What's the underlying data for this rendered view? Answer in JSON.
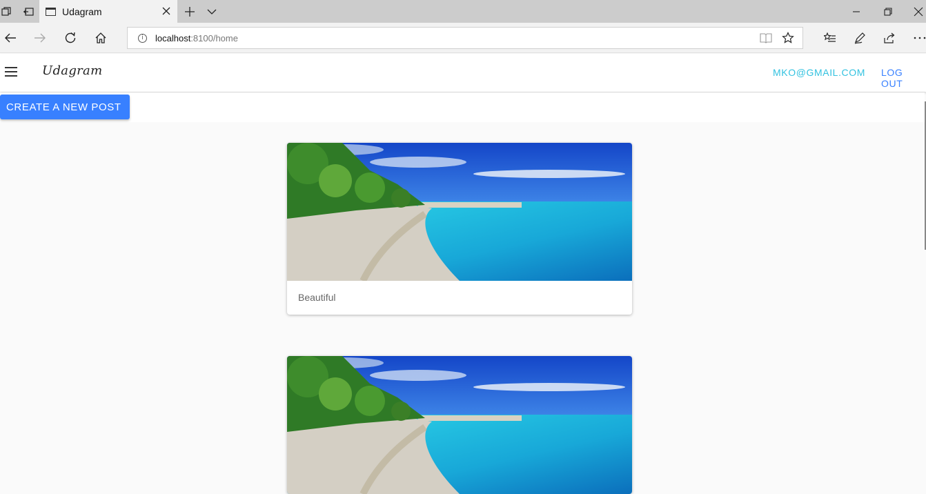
{
  "browser": {
    "tab_title": "Udagram",
    "url_host": "localhost",
    "url_rest": ":8100/home"
  },
  "app": {
    "title": "Udagram",
    "user_email": "MKO@GMAIL.COM",
    "logout_label": "LOG OUT",
    "create_button_label": "CREATE A NEW POST"
  },
  "posts": [
    {
      "caption": "Beautiful",
      "image": "beach-photo"
    },
    {
      "caption": "",
      "image": "beach-photo"
    }
  ],
  "colors": {
    "primary": "#3880ff",
    "secondary": "#33c2e0",
    "content_bg": "#fafafa"
  }
}
